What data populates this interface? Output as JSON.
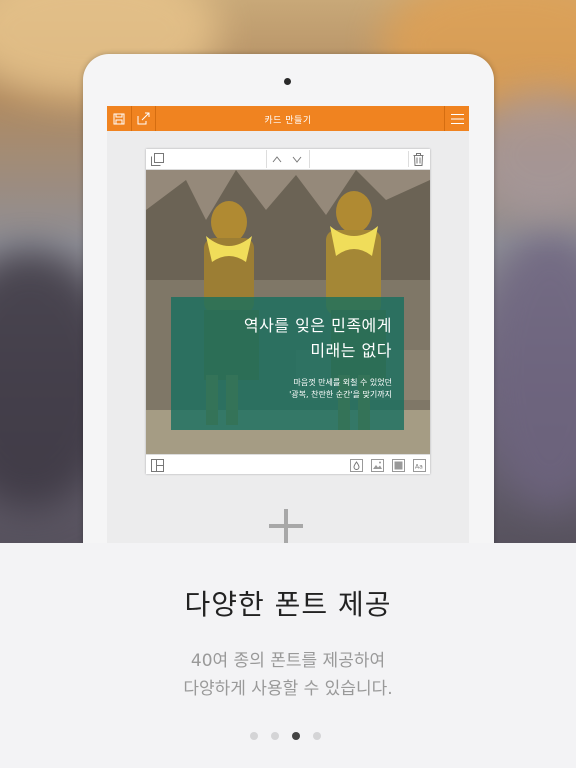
{
  "app": {
    "title": "카드 만들기"
  },
  "card": {
    "headline": "역사를 잊은 민족에게\n미래는 없다",
    "subtext": "마음껏 만세를 외칠 수 있었던\n'광복, 찬란한 순간'을 맞기까지"
  },
  "promo": {
    "title": "다양한 폰트 제공",
    "description": "40여 종의 폰트를 제공하여\n다양하게 사용할 수 있습니다."
  },
  "pager": {
    "count": 4,
    "active_index": 2
  },
  "colors": {
    "accent": "#f08320",
    "overlay": "#146e5f"
  }
}
